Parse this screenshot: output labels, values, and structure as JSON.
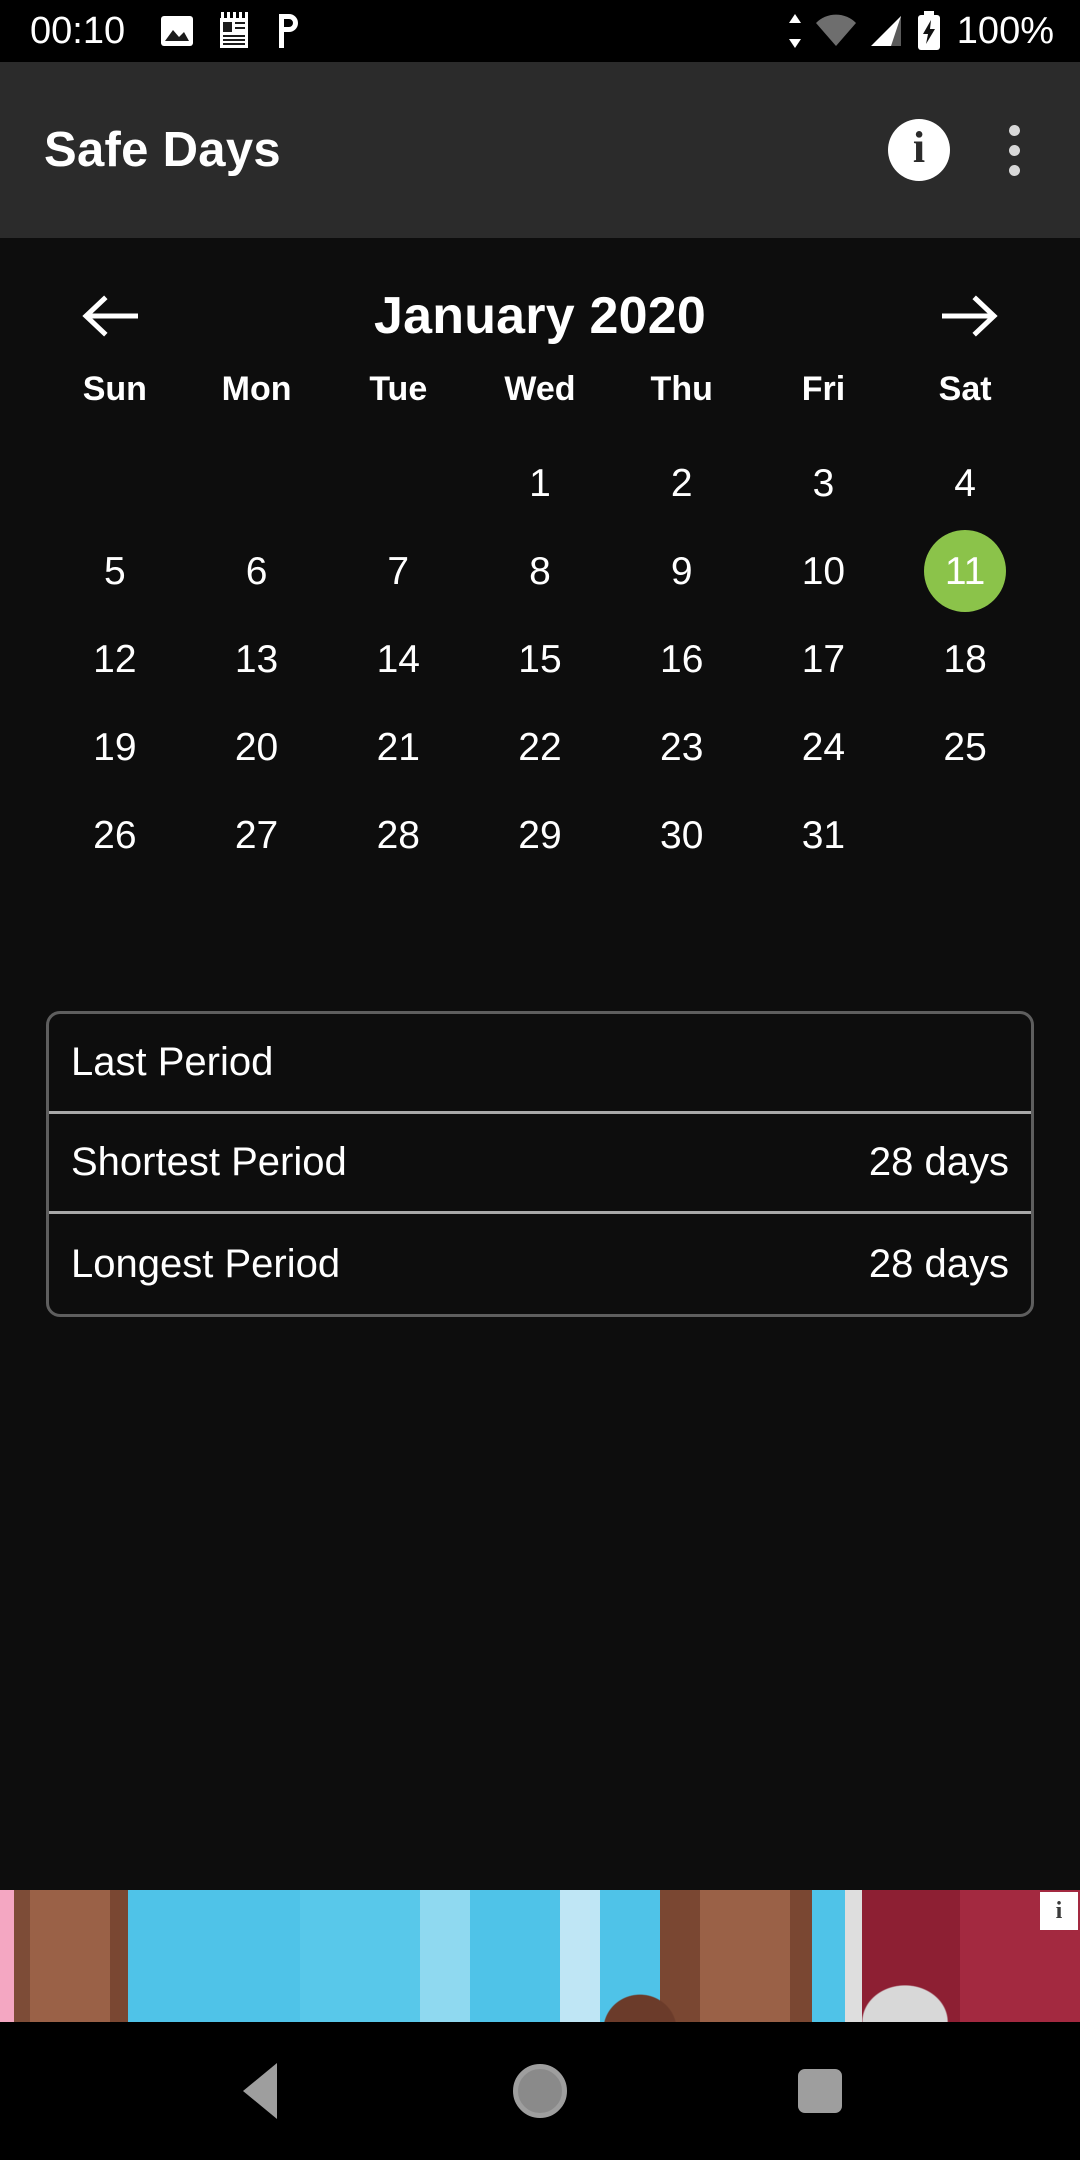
{
  "status_bar": {
    "clock": "00:10",
    "battery_text": "100%",
    "left_icons": [
      "image-icon",
      "notepad-icon",
      "letter-p-icon"
    ],
    "right_icons": [
      "data-transfer-icon",
      "wifi-icon",
      "cell-signal-icon",
      "battery-charging-icon"
    ]
  },
  "app_bar": {
    "title": "Safe Days",
    "info_glyph": "i",
    "info_action_name": "info-button",
    "overflow_action_name": "overflow-menu-button"
  },
  "calendar": {
    "month_label": "January 2020",
    "prev_label": "←",
    "next_label": "→",
    "weekdays": [
      "Sun",
      "Mon",
      "Tue",
      "Wed",
      "Thu",
      "Fri",
      "Sat"
    ],
    "leading_blanks": 3,
    "days": [
      "1",
      "2",
      "3",
      "4",
      "5",
      "6",
      "7",
      "8",
      "9",
      "10",
      "11",
      "12",
      "13",
      "14",
      "15",
      "16",
      "17",
      "18",
      "19",
      "20",
      "21",
      "22",
      "23",
      "24",
      "25",
      "26",
      "27",
      "28",
      "29",
      "30",
      "31"
    ],
    "selected_day": "11",
    "selected_color": "#8bc34a"
  },
  "summary_card": {
    "rows": [
      {
        "label": "Last Period",
        "value": ""
      },
      {
        "label": "Shortest Period",
        "value": "28 days"
      },
      {
        "label": "Longest Period",
        "value": "28 days"
      }
    ]
  },
  "ad_banner": {
    "adchoices_glyph": "i",
    "adchoices_name": "adchoices-icon"
  },
  "nav_bar": {
    "back_name": "nav-back-button",
    "home_name": "nav-home-button",
    "recents_name": "nav-recents-button"
  }
}
